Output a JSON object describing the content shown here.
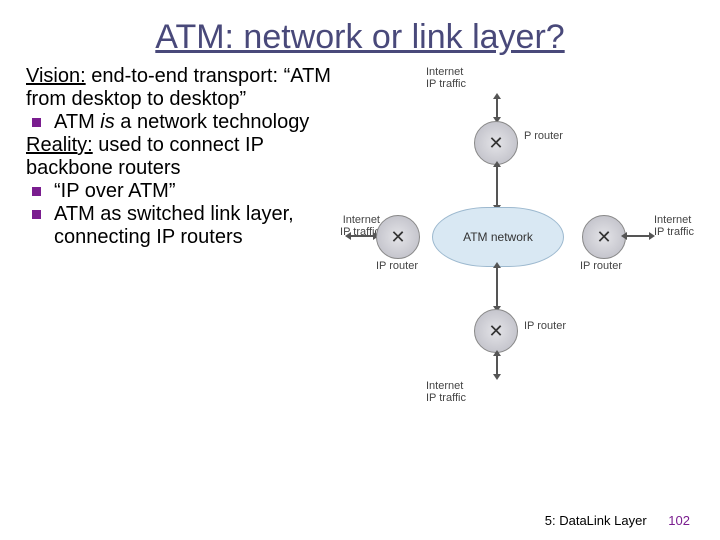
{
  "title": "ATM:  network or link layer?",
  "text": {
    "vision_label": "Vision:",
    "vision_rest": " end-to-end transport: “ATM from desktop to desktop”",
    "vision_b1_pre": "ATM ",
    "vision_b1_em": "is",
    "vision_b1_post": " a network technology",
    "reality_label": "Reality:",
    "reality_rest": " used to connect IP backbone routers",
    "reality_b1": "“IP over ATM”",
    "reality_b2": "ATM as switched link layer, connecting IP routers"
  },
  "diagram": {
    "internet_traffic": "Internet\nIP traffic",
    "ip_router_label_top": "P router",
    "ip_router_label": "IP router",
    "atm_network": "ATM network"
  },
  "footer": {
    "chapter": "5: DataLink Layer",
    "page": "102"
  }
}
